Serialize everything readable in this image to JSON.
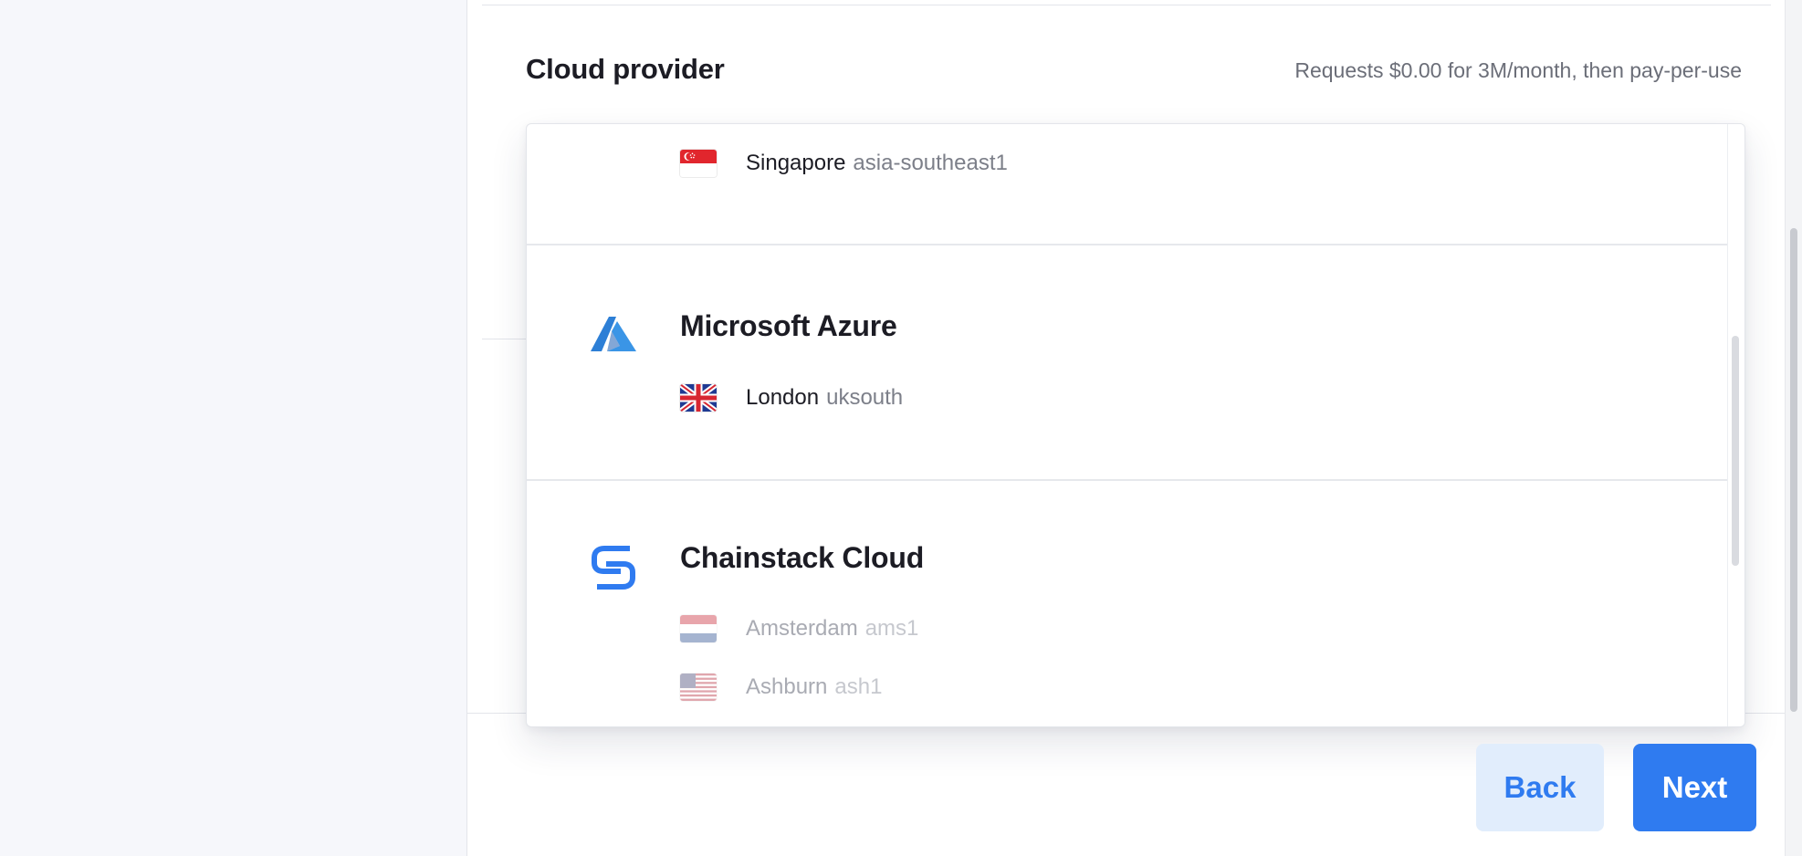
{
  "section": {
    "title": "Cloud provider",
    "pricing": "Requests $0.00 for 3M/month, then pay-per-use"
  },
  "providers": [
    {
      "name": "",
      "regions": [
        {
          "city": "Singapore",
          "code": "asia-southeast1",
          "flag": "singapore-flag",
          "enabled": true
        }
      ]
    },
    {
      "name": "Microsoft Azure",
      "logo": "azure-logo",
      "regions": [
        {
          "city": "London",
          "code": "uksouth",
          "flag": "uk-flag",
          "enabled": true
        }
      ]
    },
    {
      "name": "Chainstack Cloud",
      "logo": "chainstack-logo",
      "regions": [
        {
          "city": "Amsterdam",
          "code": "ams1",
          "flag": "netherlands-flag",
          "enabled": false
        },
        {
          "city": "Ashburn",
          "code": "ash1",
          "flag": "usa-flag",
          "enabled": false
        }
      ]
    }
  ],
  "buttons": {
    "back": "Back",
    "next": "Next"
  },
  "colors": {
    "accent": "#2f7bf0",
    "accent_light": "#e1edfc",
    "background": "#f6f7fb",
    "muted_text": "#7c7f89"
  }
}
